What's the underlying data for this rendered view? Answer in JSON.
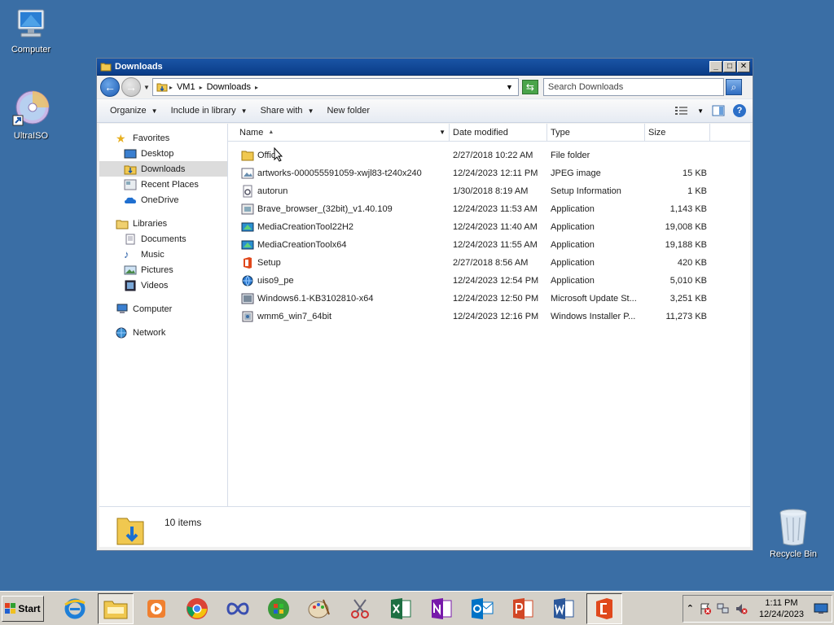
{
  "desktop": {
    "computer_label": "Computer",
    "ultraiso_label": "UltraISO",
    "recycle_label": "Recycle Bin"
  },
  "window": {
    "title": "Downloads",
    "address": {
      "root": "VM1",
      "current": "Downloads"
    },
    "search_placeholder": "Search Downloads"
  },
  "toolbar": {
    "organize": "Organize",
    "include_in_library": "Include in library",
    "share_with": "Share with",
    "new_folder": "New folder"
  },
  "navpane": {
    "favorites": "Favorites",
    "desktop": "Desktop",
    "downloads": "Downloads",
    "recent_places": "Recent Places",
    "onedrive": "OneDrive",
    "libraries": "Libraries",
    "documents": "Documents",
    "music": "Music",
    "pictures": "Pictures",
    "videos": "Videos",
    "computer": "Computer",
    "network": "Network"
  },
  "columns": {
    "name": "Name",
    "date": "Date modified",
    "type": "Type",
    "size": "Size"
  },
  "files": [
    {
      "name": "Office",
      "date": "2/27/2018 10:22 AM",
      "type": "File folder",
      "size": "",
      "icon": "folder-icon"
    },
    {
      "name": "artworks-000055591059-xwjl83-t240x240",
      "date": "12/24/2023 12:11 PM",
      "type": "JPEG image",
      "size": "15 KB",
      "icon": "image-icon"
    },
    {
      "name": "autorun",
      "date": "1/30/2018 8:19 AM",
      "type": "Setup Information",
      "size": "1 KB",
      "icon": "settings-file-icon"
    },
    {
      "name": "Brave_browser_(32bit)_v1.40.109",
      "date": "12/24/2023 11:53 AM",
      "type": "Application",
      "size": "1,143 KB",
      "icon": "installer-icon"
    },
    {
      "name": "MediaCreationTool22H2",
      "date": "12/24/2023 11:40 AM",
      "type": "Application",
      "size": "19,008 KB",
      "icon": "media-tool-icon"
    },
    {
      "name": "MediaCreationToolx64",
      "date": "12/24/2023 11:55 AM",
      "type": "Application",
      "size": "19,188 KB",
      "icon": "media-tool-icon"
    },
    {
      "name": "Setup",
      "date": "2/27/2018 8:56 AM",
      "type": "Application",
      "size": "420 KB",
      "icon": "office-icon"
    },
    {
      "name": "uiso9_pe",
      "date": "12/24/2023 12:54 PM",
      "type": "Application",
      "size": "5,010 KB",
      "icon": "globe-installer-icon"
    },
    {
      "name": "Windows6.1-KB3102810-x64",
      "date": "12/24/2023 12:50 PM",
      "type": "Microsoft Update St...",
      "size": "3,251 KB",
      "icon": "update-package-icon"
    },
    {
      "name": "wmm6_win7_64bit",
      "date": "12/24/2023 12:16 PM",
      "type": "Windows Installer P...",
      "size": "11,273 KB",
      "icon": "msi-package-icon"
    }
  ],
  "status": {
    "count": "10 items"
  },
  "taskbar": {
    "start": "Start",
    "time": "1:11 PM",
    "date": "12/24/2023"
  },
  "colors": {
    "desktop": "#3a6ea5",
    "titlebar": "#0a3c87"
  }
}
